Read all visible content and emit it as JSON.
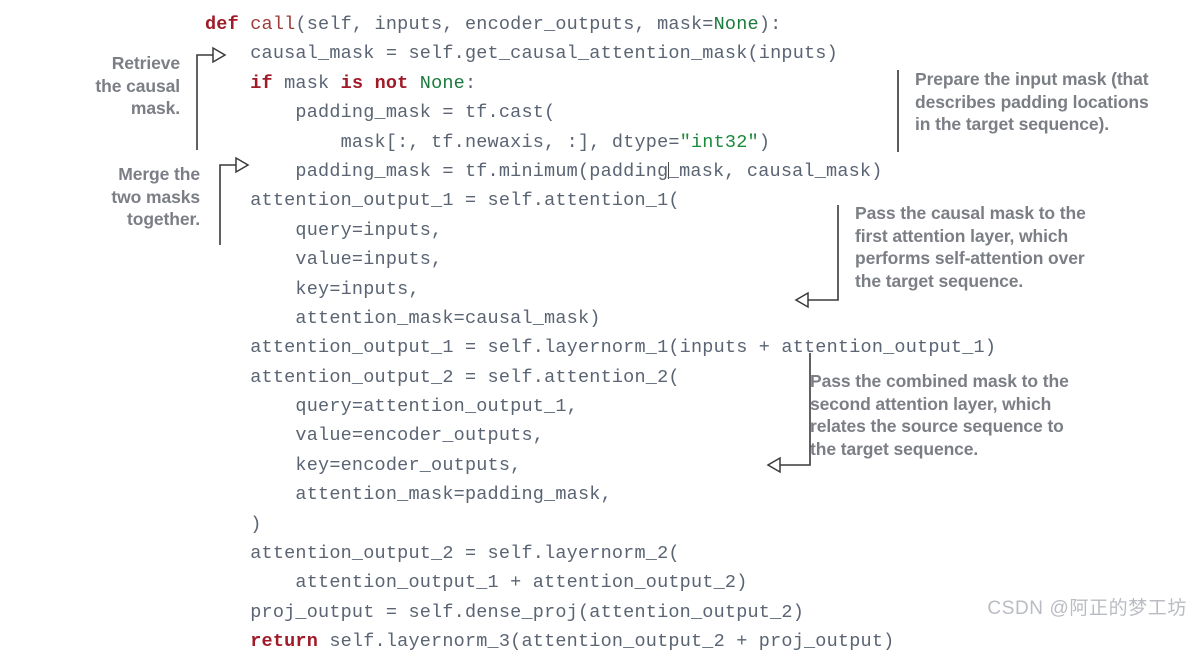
{
  "figure": {
    "kind": "annotated-code-figure",
    "language": "python",
    "code_text_color": "#5a6473",
    "keyword_color": "#a01a28",
    "function_color": "#9d3b36",
    "constant_color": "#1a7a3c",
    "string_color": "#1a8a3c",
    "annotation_color": "#7b7e85",
    "connector_color": "#3a3a3a",
    "background_color": "#ffffff"
  },
  "code": {
    "lines": [
      {
        "id": "line-1",
        "indent": 0,
        "tokens": [
          {
            "t": "def",
            "c": "kw"
          },
          {
            "t": " ",
            "c": "plain"
          },
          {
            "t": "call",
            "c": "fn"
          },
          {
            "t": "(self, inputs, encoder_outputs, mask=",
            "c": "plain"
          },
          {
            "t": "None",
            "c": "const"
          },
          {
            "t": "):",
            "c": "plain"
          }
        ]
      },
      {
        "id": "line-2",
        "indent": 1,
        "tokens": [
          {
            "t": "causal_mask = self.get_causal_attention_mask(inputs)",
            "c": "plain"
          }
        ]
      },
      {
        "id": "line-3",
        "indent": 1,
        "tokens": [
          {
            "t": "if",
            "c": "kw"
          },
          {
            "t": " mask ",
            "c": "plain"
          },
          {
            "t": "is",
            "c": "kw"
          },
          {
            "t": " ",
            "c": "plain"
          },
          {
            "t": "not",
            "c": "kw"
          },
          {
            "t": " ",
            "c": "plain"
          },
          {
            "t": "None",
            "c": "const"
          },
          {
            "t": ":",
            "c": "plain"
          }
        ]
      },
      {
        "id": "line-4",
        "indent": 2,
        "tokens": [
          {
            "t": "padding_mask = tf.cast(",
            "c": "plain"
          }
        ]
      },
      {
        "id": "line-5",
        "indent": 3,
        "tokens": [
          {
            "t": "mask[:, tf.newaxis, :], dtype=",
            "c": "plain"
          },
          {
            "t": "\"int32\"",
            "c": "str"
          },
          {
            "t": ")",
            "c": "plain"
          }
        ]
      },
      {
        "id": "line-6",
        "indent": 2,
        "tokens": [
          {
            "t": "padding_mask = tf.minimum(padding",
            "c": "plain"
          },
          {
            "t": "|CARET|",
            "c": "caret"
          },
          {
            "t": "_mask, causal_mask)",
            "c": "plain"
          }
        ]
      },
      {
        "id": "line-7",
        "indent": 1,
        "tokens": [
          {
            "t": "attention_output_1 = self.attention_1(",
            "c": "plain"
          }
        ]
      },
      {
        "id": "line-8",
        "indent": 2,
        "tokens": [
          {
            "t": "query=inputs,",
            "c": "plain"
          }
        ]
      },
      {
        "id": "line-9",
        "indent": 2,
        "tokens": [
          {
            "t": "value=inputs,",
            "c": "plain"
          }
        ]
      },
      {
        "id": "line-10",
        "indent": 2,
        "tokens": [
          {
            "t": "key=inputs,",
            "c": "plain"
          }
        ]
      },
      {
        "id": "line-11",
        "indent": 2,
        "tokens": [
          {
            "t": "attention_mask=causal_mask)",
            "c": "plain"
          }
        ]
      },
      {
        "id": "line-12",
        "indent": 1,
        "tokens": [
          {
            "t": "attention_output_1 = self.layernorm_1(inputs + attention_output_1)",
            "c": "plain"
          }
        ]
      },
      {
        "id": "line-13",
        "indent": 1,
        "tokens": [
          {
            "t": "attention_output_2 = self.attention_2(",
            "c": "plain"
          }
        ]
      },
      {
        "id": "line-14",
        "indent": 2,
        "tokens": [
          {
            "t": "query=attention_output_1,",
            "c": "plain"
          }
        ]
      },
      {
        "id": "line-15",
        "indent": 2,
        "tokens": [
          {
            "t": "value=encoder_outputs,",
            "c": "plain"
          }
        ]
      },
      {
        "id": "line-16",
        "indent": 2,
        "tokens": [
          {
            "t": "key=encoder_outputs,",
            "c": "plain"
          }
        ]
      },
      {
        "id": "line-17",
        "indent": 2,
        "tokens": [
          {
            "t": "attention_mask=padding_mask,",
            "c": "plain"
          }
        ]
      },
      {
        "id": "line-18",
        "indent": 1,
        "tokens": [
          {
            "t": ")",
            "c": "plain"
          }
        ]
      },
      {
        "id": "line-19",
        "indent": 1,
        "tokens": [
          {
            "t": "attention_output_2 = self.layernorm_2(",
            "c": "plain"
          }
        ]
      },
      {
        "id": "line-20",
        "indent": 2,
        "tokens": [
          {
            "t": "attention_output_1 + attention_output_2)",
            "c": "plain"
          }
        ]
      },
      {
        "id": "line-21",
        "indent": 1,
        "tokens": [
          {
            "t": "proj_output = self.dense_proj(attention_output_2)",
            "c": "plain"
          }
        ]
      },
      {
        "id": "line-22",
        "indent": 1,
        "tokens": [
          {
            "t": "return",
            "c": "kw"
          },
          {
            "t": " self.layernorm_3(attention_output_2 + proj_output)",
            "c": "plain"
          }
        ]
      }
    ]
  },
  "annotations": [
    {
      "id": "annotation-retrieve-causal-mask",
      "side": "left",
      "align": "right",
      "lines": [
        "Retrieve",
        "the causal",
        "mask."
      ]
    },
    {
      "id": "annotation-merge-two-masks",
      "side": "left",
      "align": "right",
      "lines": [
        "Merge the",
        "two masks",
        "together."
      ]
    },
    {
      "id": "annotation-prepare-input-mask",
      "side": "right",
      "align": "left",
      "lines": [
        "Prepare the input mask (that",
        "describes padding locations",
        "in the target sequence)."
      ]
    },
    {
      "id": "annotation-pass-causal-mask",
      "side": "right",
      "align": "left",
      "lines": [
        "Pass the causal mask to the",
        "first attention layer, which",
        "performs self-attention over",
        "the target sequence."
      ]
    },
    {
      "id": "annotation-pass-combined-mask",
      "side": "right",
      "align": "left",
      "lines": [
        "Pass the combined mask to the",
        "second attention layer, which",
        "relates the source sequence to",
        "the target sequence."
      ]
    }
  ],
  "watermark": {
    "text": "CSDN @阿正的梦工坊"
  }
}
